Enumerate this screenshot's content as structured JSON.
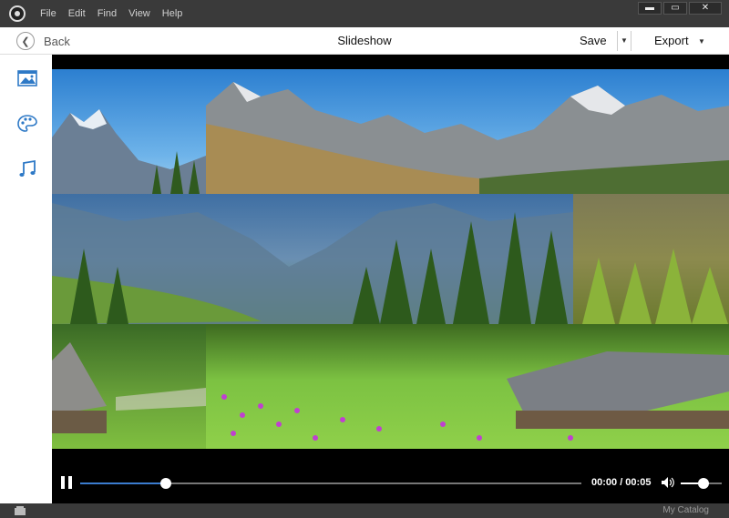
{
  "menubar": {
    "items": [
      "File",
      "Edit",
      "Find",
      "View",
      "Help"
    ]
  },
  "window_controls": {
    "minimize": "▬",
    "maximize": "▭",
    "close": "✕"
  },
  "toolbar": {
    "back_label": "Back",
    "title": "Slideshow",
    "save_label": "Save",
    "export_label": "Export"
  },
  "sidebar": {
    "items": [
      {
        "name": "media-icon"
      },
      {
        "name": "themes-palette-icon"
      },
      {
        "name": "audio-music-icon"
      }
    ]
  },
  "player": {
    "time": "00:00 / 00:05",
    "progress_fraction": 0.17,
    "volume_fraction": 0.55
  },
  "statusbar": {
    "catalog_label": "My Catalog"
  },
  "colors": {
    "accent": "#3b7ccf",
    "chrome": "#3a3a3a"
  }
}
